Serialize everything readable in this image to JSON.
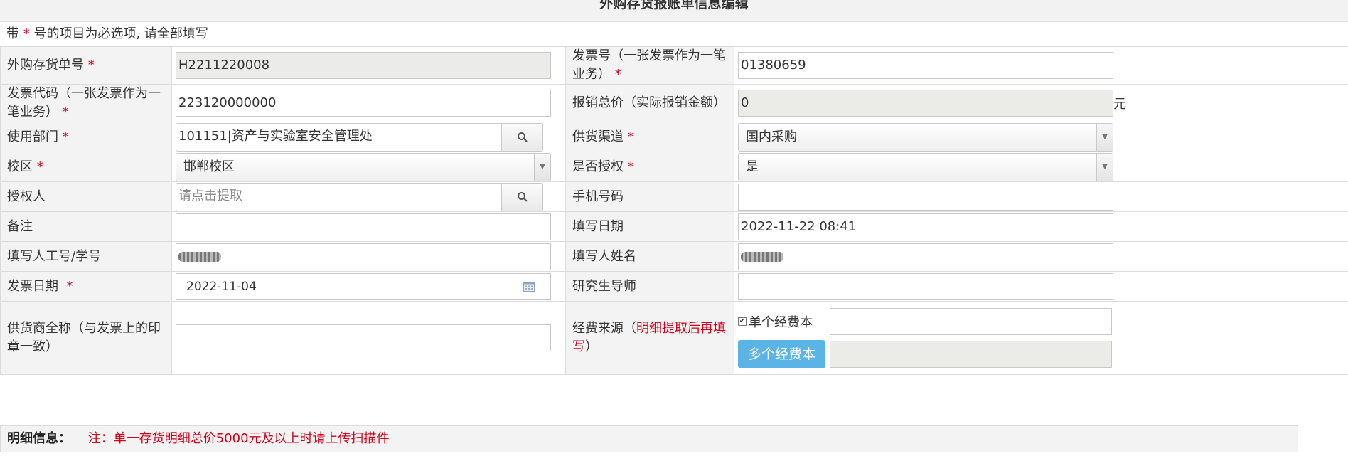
{
  "page_title": "外购存货报账单信息编辑",
  "notice": {
    "prefix": "带",
    "star": "*",
    "suffix": "号的项目为必选项, 请全部填写"
  },
  "required_mark": "*",
  "fields": {
    "order_no": {
      "label": "外购存货单号",
      "value": "H2211220008"
    },
    "invoice_no": {
      "label": "发票号（一张发票作为一笔业务）",
      "value": "01380659"
    },
    "invoice_code": {
      "label": "发票代码（一张发票作为一笔业务）",
      "value": "223120000000"
    },
    "total_price": {
      "label": "报销总价（实际报销金额）",
      "value": "0",
      "unit": "元"
    },
    "department": {
      "label": "使用部门",
      "value": "101151|资产与实验室安全管理处"
    },
    "channel": {
      "label": "供货渠道",
      "value": "国内采购"
    },
    "campus": {
      "label": "校区",
      "value": "邯郸校区"
    },
    "authorized": {
      "label": "是否授权",
      "value": "是"
    },
    "authorizer": {
      "label": "授权人",
      "placeholder": "请点击提取"
    },
    "phone": {
      "label": "手机号码",
      "value": ""
    },
    "remark": {
      "label": "备注",
      "value": ""
    },
    "fill_date": {
      "label": "填写日期",
      "value": "2022-11-22 08:41"
    },
    "filler_id": {
      "label": "填写人工号/学号"
    },
    "filler_name": {
      "label": "填写人姓名"
    },
    "invoice_date": {
      "label": "发票日期",
      "value": "2022-11-04"
    },
    "supervisor": {
      "label": "研究生导师",
      "value": ""
    },
    "supplier": {
      "label": "供货商全称（与发票上的印章一致）",
      "value": ""
    },
    "fund_source": {
      "label_prefix": "经费来源（",
      "label_red": "明细提取后再填写",
      "label_suffix": "）",
      "single_label": "单个经费本",
      "multi_button": "多个经费本",
      "single_checked": true
    }
  },
  "detail": {
    "label": "明细信息：",
    "note": "注：单一存货明细总价5000元及以上时请上传扫描件"
  },
  "colors": {
    "required": "#d0021b",
    "button": "#5ab4e6",
    "label_bg": "#f3f3f3",
    "readonly_bg": "#ebebe7"
  }
}
